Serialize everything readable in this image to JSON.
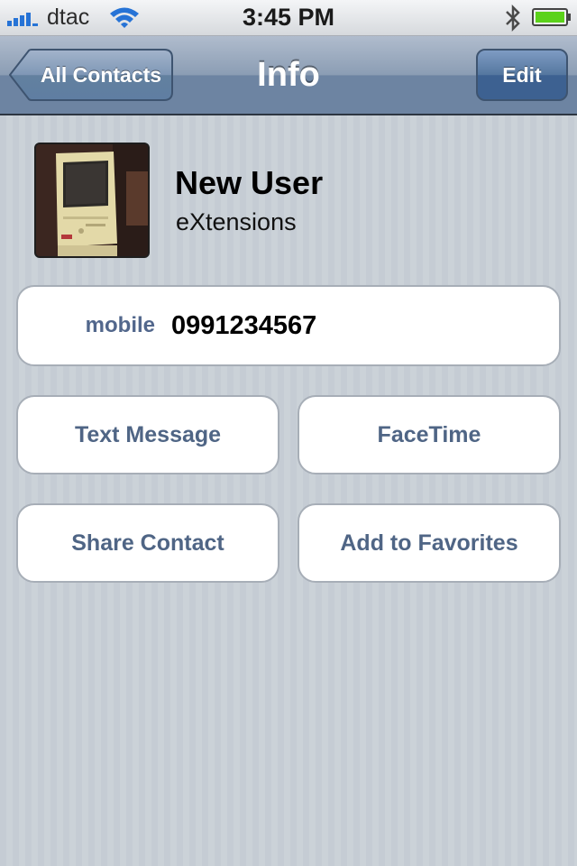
{
  "status_bar": {
    "carrier": "dtac",
    "time": "3:45 PM",
    "icons": [
      "signal-icon",
      "wifi-icon",
      "bluetooth-icon",
      "battery-icon"
    ]
  },
  "nav_bar": {
    "back_label": "All Contacts",
    "title": "Info",
    "edit_label": "Edit"
  },
  "contact": {
    "name": "New User",
    "company": "eXtensions",
    "phone": {
      "label": "mobile",
      "number": "0991234567"
    }
  },
  "actions": {
    "text_message": "Text Message",
    "facetime": "FaceTime",
    "share_contact": "Share Contact",
    "add_favorites": "Add to Favorites"
  },
  "colors": {
    "nav_bar": "#6d84a2",
    "background": "#c5ccd4",
    "action_text": "#4f6585",
    "battery": "#5bd21a"
  }
}
